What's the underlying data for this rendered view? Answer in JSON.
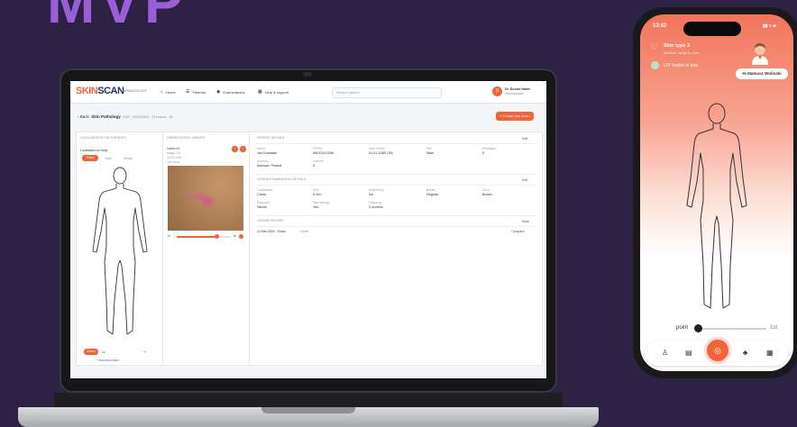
{
  "headline": "MVP",
  "app": {
    "logo_a": "SKIN",
    "logo_b": "SCAN",
    "logo_sub": "DERMATOLOGY",
    "nav": [
      {
        "icon": "⌂",
        "label": "Home"
      },
      {
        "icon": "☰",
        "label": "Patients"
      },
      {
        "icon": "◉",
        "label": "Examinations"
      },
      {
        "icon": "▦",
        "label": "Help & support"
      }
    ],
    "search_placeholder": "Search patient",
    "user": {
      "initial": "D",
      "name": "Dr. Doctor Name",
      "role": "Dermatologist"
    },
    "breadcrumb": {
      "back": "‹ Back",
      "title": "Skin Pathology",
      "meta": "ID#2 · 02/03/2024 · 12 lesions · 30"
    },
    "new_button": "+ Create new exam",
    "left_panel": {
      "title": "Localization on the body",
      "subtitle": "Localization on body",
      "tabs": [
        "Front",
        "Back",
        "Details"
      ],
      "zoom_label": "Zoom",
      "zoom_value": "1x",
      "footer_link": "+ Add new lesion"
    },
    "mid_panel": {
      "title": "Dermoscopic images",
      "meta": [
        "Lesion #1",
        "Image 1/4",
        "12.03.2024",
        "Left chest"
      ]
    },
    "patient": {
      "title": "Patient details",
      "edit": "Edit",
      "fields": [
        {
          "label": "Name",
          "value": "Jan Kowalski"
        },
        {
          "label": "PESEL",
          "value": "85010112345"
        },
        {
          "label": "Date of birth",
          "value": "01.01.1985 (39)"
        },
        {
          "label": "Sex",
          "value": "Male"
        },
        {
          "label": "Phototype",
          "value": "II"
        },
        {
          "label": "Address",
          "value": "Warsaw, Poland"
        },
        {
          "label": "Lesions",
          "value": "3"
        }
      ]
    },
    "lesion": {
      "title": "Lesion examination details",
      "edit": "Edit",
      "fields": [
        {
          "label": "Localization",
          "value": "Chest"
        },
        {
          "label": "Size",
          "value": "6 mm"
        },
        {
          "label": "Asymmetry",
          "value": "No"
        },
        {
          "label": "Border",
          "value": "Regular"
        },
        {
          "label": "Color",
          "value": "Brown"
        },
        {
          "label": "Diagnosis",
          "value": "Nevus"
        },
        {
          "label": "Dermoscopy",
          "value": "Yes"
        },
        {
          "label": "Follow up",
          "value": "3 months"
        }
      ]
    },
    "history": {
      "title": "Lesion history",
      "link": "More",
      "row_label": "12 Mar 2024 · Exam",
      "row_action": "Compare",
      "status": "Stable"
    }
  },
  "phone": {
    "time": "13:42",
    "status": "▮▮ ≈ ▰",
    "skin_type": "Skin type 3",
    "skin_sub": "Medium, white to olive",
    "uv": "UV Index is low",
    "pill": "Hi Mateusz Wolinski",
    "slider_label": "point",
    "slider_end": "1st"
  }
}
